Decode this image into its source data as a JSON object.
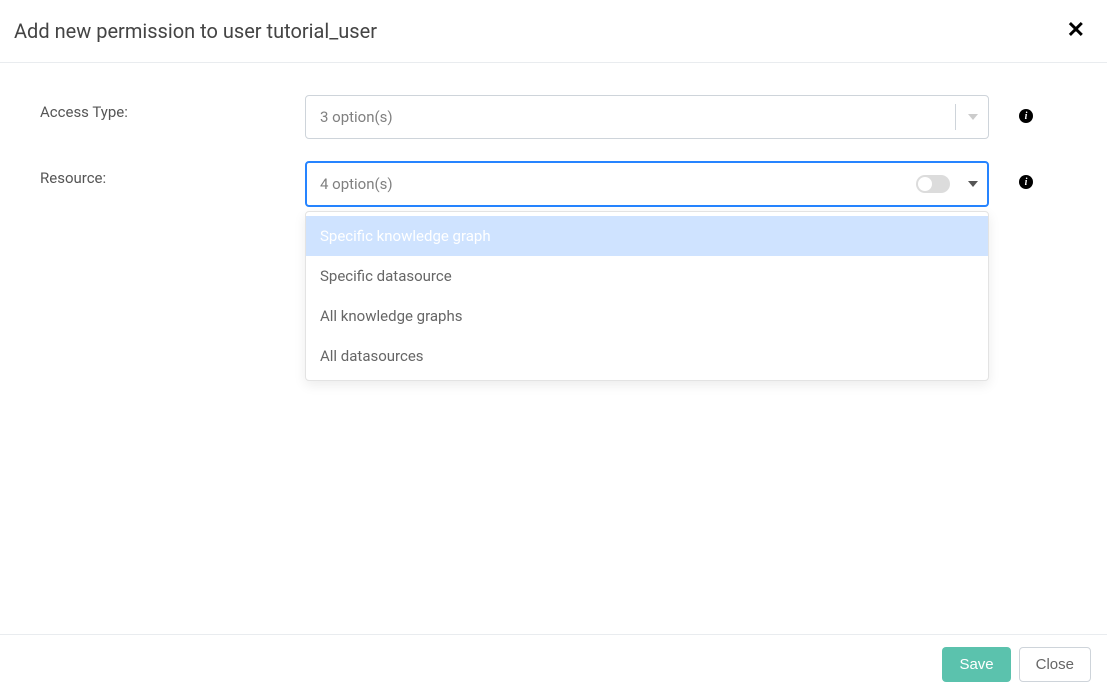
{
  "header": {
    "title": "Add new permission to user tutorial_user"
  },
  "form": {
    "access_type": {
      "label": "Access Type:",
      "selected": "3 option(s)"
    },
    "resource": {
      "label": "Resource:",
      "selected": "4 option(s)",
      "options": [
        "Specific knowledge graph",
        "Specific datasource",
        "All knowledge graphs",
        "All datasources"
      ]
    }
  },
  "footer": {
    "save": "Save",
    "close": "Close"
  }
}
